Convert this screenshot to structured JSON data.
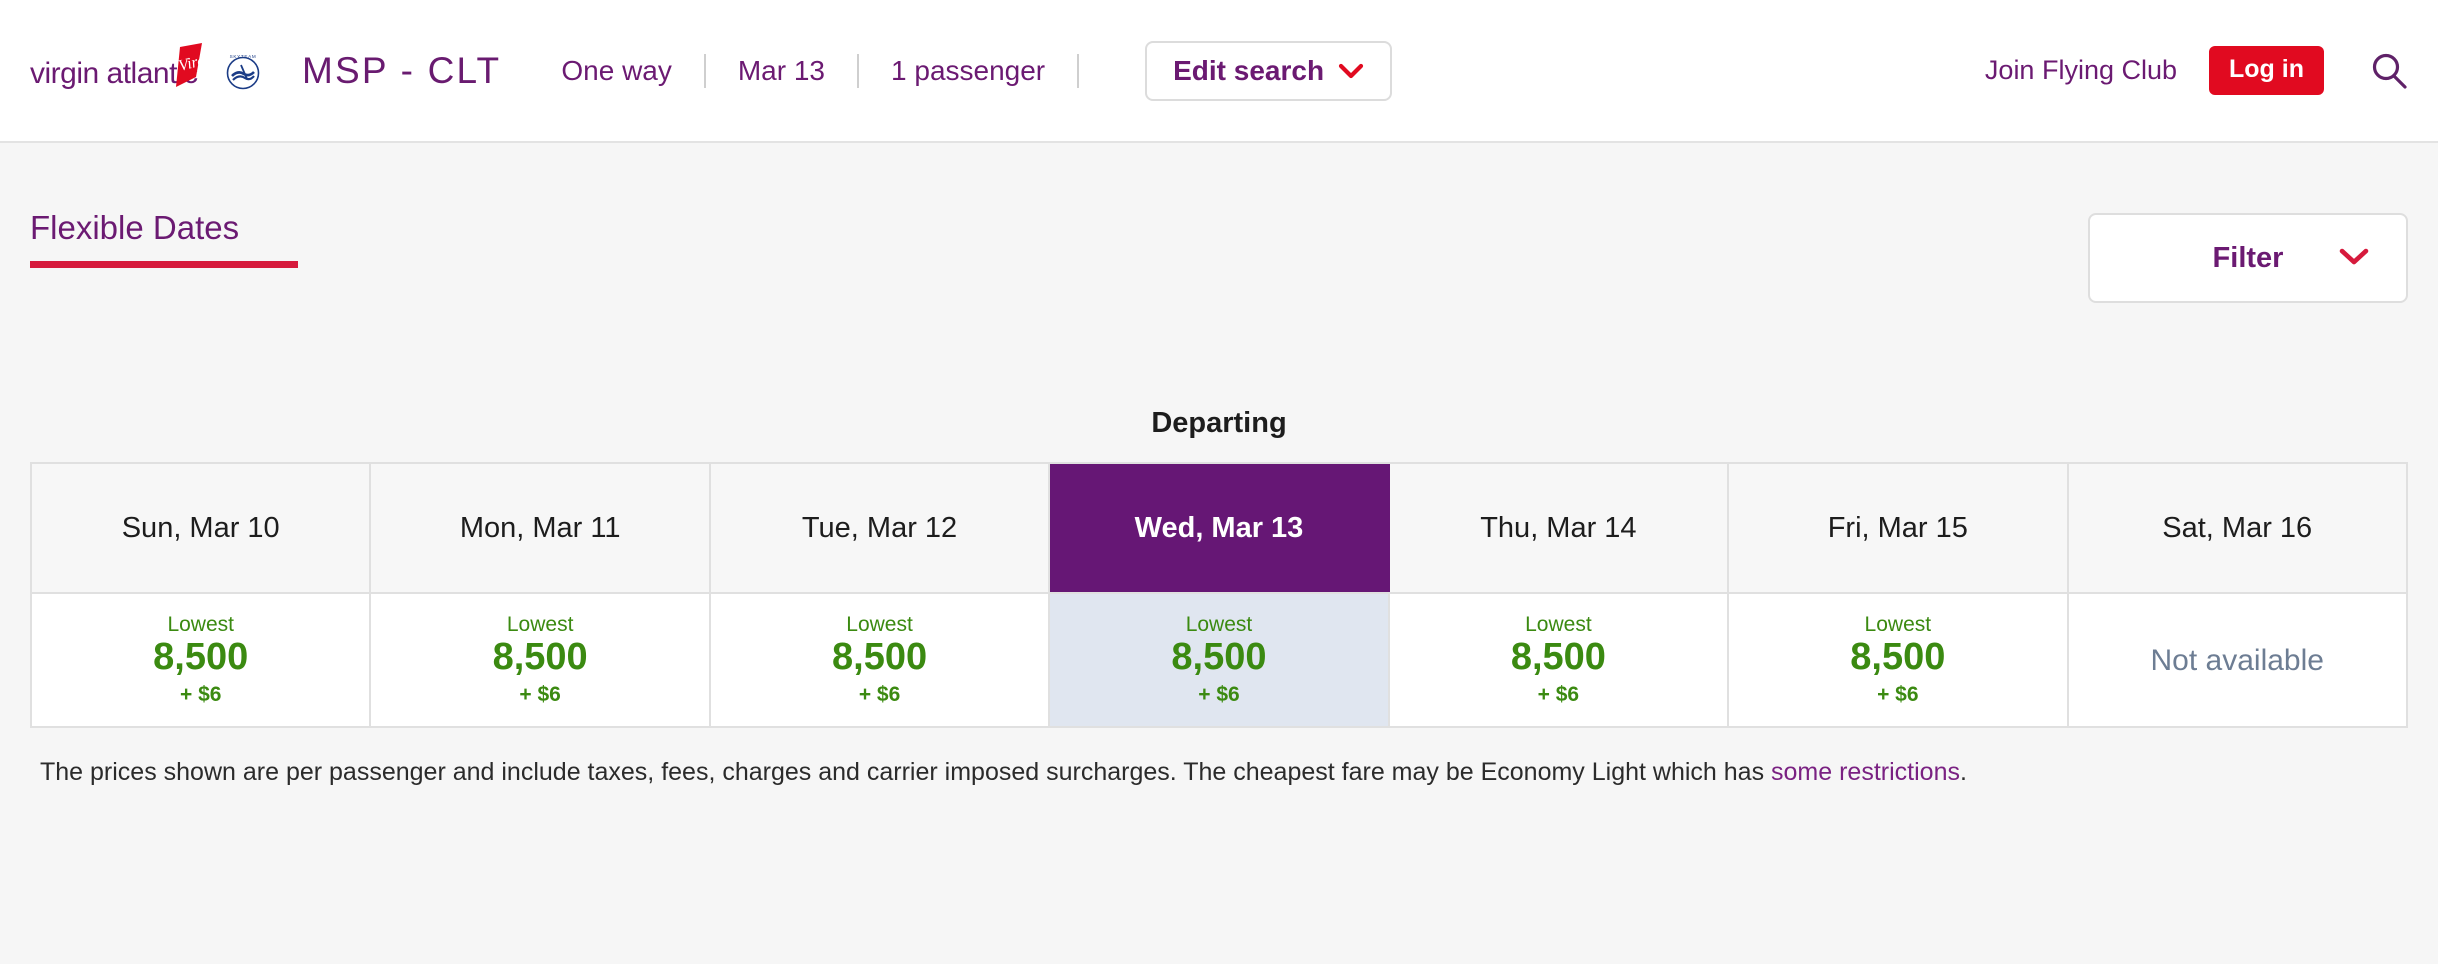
{
  "header": {
    "brand_name": "virgin atlantic",
    "alliance_logo": "skyteam-logo",
    "route": "MSP - CLT",
    "nav": [
      {
        "label": "One way",
        "name": "trip-type"
      },
      {
        "label": "Mar 13",
        "name": "travel-date"
      },
      {
        "label": "1 passenger",
        "name": "passenger-count"
      }
    ],
    "edit_search_label": "Edit search",
    "join_label": "Join Flying Club",
    "login_label": "Log in",
    "search_icon": "search-icon",
    "chevron_icon": "chevron-down-icon"
  },
  "toolbar": {
    "tab_label": "Flexible Dates",
    "filter_label": "Filter",
    "filter_chevron_icon": "chevron-down-icon"
  },
  "results": {
    "direction_title": "Departing",
    "columns": [
      {
        "date": "Sun, Mar 10",
        "lowest_label": "Lowest",
        "points": "8,500",
        "tax": "+ $6",
        "available": true,
        "selected": false
      },
      {
        "date": "Mon, Mar 11",
        "lowest_label": "Lowest",
        "points": "8,500",
        "tax": "+ $6",
        "available": true,
        "selected": false
      },
      {
        "date": "Tue, Mar 12",
        "lowest_label": "Lowest",
        "points": "8,500",
        "tax": "+ $6",
        "available": true,
        "selected": false
      },
      {
        "date": "Wed, Mar 13",
        "lowest_label": "Lowest",
        "points": "8,500",
        "tax": "+ $6",
        "available": true,
        "selected": true
      },
      {
        "date": "Thu, Mar 14",
        "lowest_label": "Lowest",
        "points": "8,500",
        "tax": "+ $6",
        "available": true,
        "selected": false
      },
      {
        "date": "Fri, Mar 15",
        "lowest_label": "Lowest",
        "points": "8,500",
        "tax": "+ $6",
        "available": true,
        "selected": false
      },
      {
        "date": "Sat, Mar 16",
        "unavailable_label": "Not available",
        "available": false,
        "selected": false
      }
    ]
  },
  "disclaimer": {
    "text": "The prices shown are per passenger and include taxes, fees, charges and carrier imposed surcharges. The cheapest fare may be Economy Light which has ",
    "link_text": "some restrictions",
    "suffix": "."
  },
  "colors": {
    "brand_purple": "#661775",
    "link_purple": "#6b1a72",
    "accent_red": "#e10a20",
    "underline_red": "#d61a3c",
    "price_green": "#3b8a11",
    "unavailable_grey": "#6d7d93",
    "selected_cell_bg": "#e0e6f0",
    "page_bg": "#f6f6f6"
  }
}
